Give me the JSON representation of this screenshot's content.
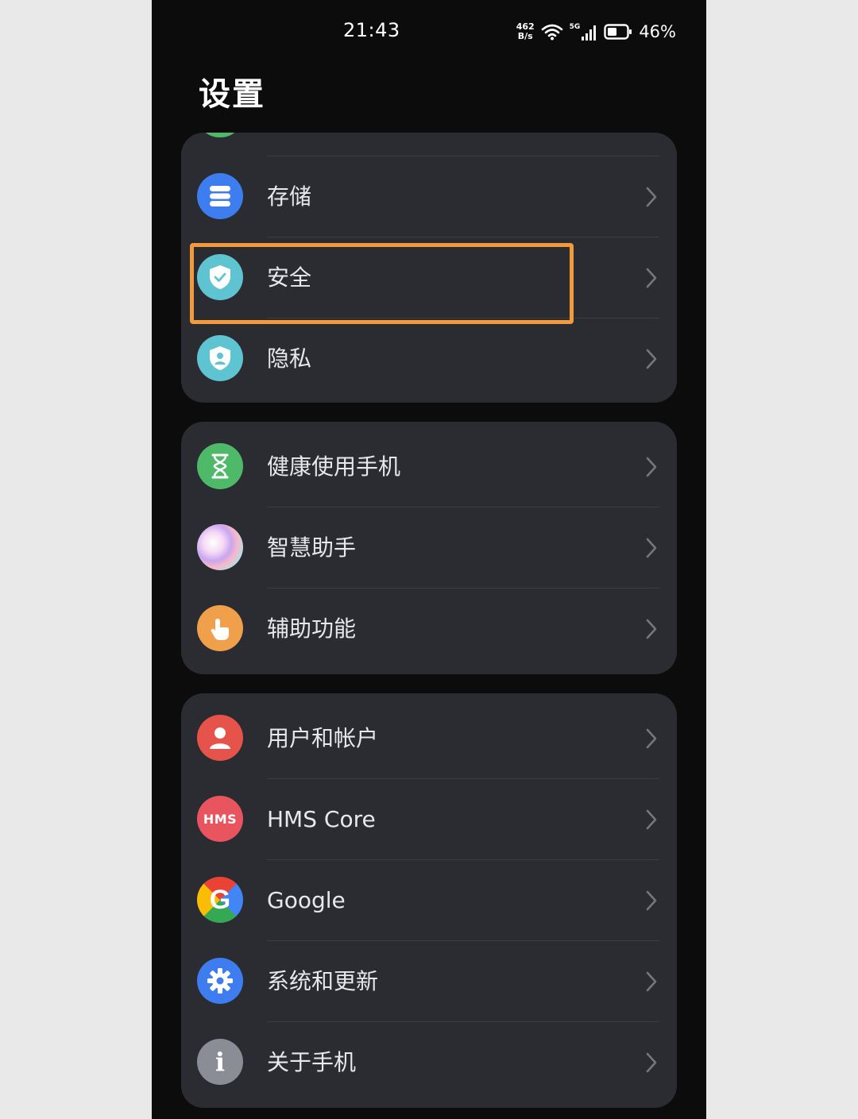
{
  "status_bar": {
    "time": "21:43",
    "net_speed_value": "462",
    "net_speed_unit": "B/s",
    "signal_tag": "5G",
    "battery_percent": "46%"
  },
  "page": {
    "title": "设置"
  },
  "groups": [
    {
      "items": [
        {
          "label": "存储",
          "icon": "storage-icon",
          "color": "#3d7df0"
        },
        {
          "label": "安全",
          "icon": "security-shield-icon",
          "color": "#5fc4d1"
        },
        {
          "label": "隐私",
          "icon": "privacy-shield-icon",
          "color": "#5fc4d1"
        }
      ]
    },
    {
      "items": [
        {
          "label": "健康使用手机",
          "icon": "hourglass-icon",
          "color": "#4fb96a"
        },
        {
          "label": "智慧助手",
          "icon": "assistant-orb-icon",
          "color": "#e4b7ec"
        },
        {
          "label": "辅助功能",
          "icon": "hand-tap-icon",
          "color": "#f0a04b"
        }
      ]
    },
    {
      "items": [
        {
          "label": "用户和帐户",
          "icon": "user-icon",
          "color": "#e5534b"
        },
        {
          "label": "HMS Core",
          "icon": "hms-icon",
          "icon_text": "HMS",
          "color": "#e8555f"
        },
        {
          "label": "Google",
          "icon": "google-icon",
          "icon_text": "G",
          "color": "#ffffff"
        },
        {
          "label": "系统和更新",
          "icon": "gear-icon",
          "color": "#3d7df0"
        },
        {
          "label": "关于手机",
          "icon": "info-icon",
          "icon_text": "i",
          "color": "#8a8d96"
        }
      ]
    }
  ],
  "highlight_color": "#f39a3c"
}
